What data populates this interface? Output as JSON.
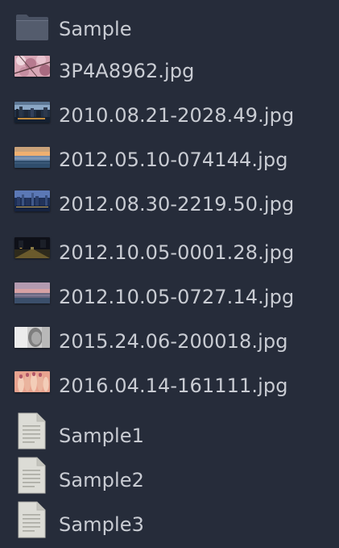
{
  "files": [
    {
      "name": "Sample",
      "type": "folder",
      "icon": "folder-icon"
    },
    {
      "name": "3P4A8962.jpg",
      "type": "image",
      "icon": "image-thumbnail",
      "thumb": [
        "#d8a7b6",
        "#a86a80",
        "#efd7de"
      ]
    },
    {
      "name": "2010.08.21-2028.49.jpg",
      "type": "image",
      "icon": "image-thumbnail",
      "thumb": [
        "#223044",
        "#8aa6c4",
        "#c08a3c"
      ]
    },
    {
      "name": "2012.05.10-074144.jpg",
      "type": "image",
      "icon": "image-thumbnail",
      "thumb": [
        "#f0b070",
        "#6d87a8",
        "#2f4d6c"
      ]
    },
    {
      "name": "2012.08.30-2219.50.jpg",
      "type": "image",
      "icon": "image-thumbnail",
      "thumb": [
        "#1c2e55",
        "#5b78b5",
        "#c7a65a"
      ]
    },
    {
      "name": "2012.10.05-0001.28.jpg",
      "type": "image",
      "icon": "image-thumbnail",
      "thumb": [
        "#0e1018",
        "#6a5a2c",
        "#e2b04a"
      ]
    },
    {
      "name": "2012.10.05-0727.14.jpg",
      "type": "image",
      "icon": "image-thumbnail",
      "thumb": [
        "#8c7488",
        "#d7a1a4",
        "#3b4f6b"
      ]
    },
    {
      "name": "2015.24.06-200018.jpg",
      "type": "image",
      "icon": "image-thumbnail",
      "thumb": [
        "#cfcfcf",
        "#7e7e7e",
        "#ececec"
      ]
    },
    {
      "name": "2016.04.14-161111.jpg",
      "type": "image",
      "icon": "image-thumbnail",
      "thumb": [
        "#e8a38f",
        "#b25868",
        "#f3cdb8"
      ]
    },
    {
      "name": "Sample1",
      "type": "document",
      "icon": "text-document-icon"
    },
    {
      "name": "Sample2",
      "type": "document",
      "icon": "text-document-icon"
    },
    {
      "name": "Sample3",
      "type": "document",
      "icon": "text-document-icon"
    }
  ],
  "colors": {
    "background": "#262c3a",
    "text": "#c9ccd3",
    "folder": "#4a5263",
    "document": "#dcdcd6"
  }
}
